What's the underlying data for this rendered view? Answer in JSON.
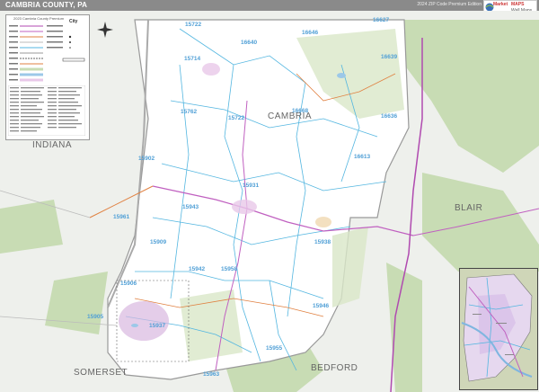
{
  "header": {
    "title": "CAMBRIA COUNTY, PA",
    "edition": "2024 ZIP Code Premium Edition"
  },
  "logo": {
    "line1": "Market",
    "line2": "MAPS",
    "line3": "Wall Maps"
  },
  "legend": {
    "title": "2023 Cambria County Premium",
    "city_label": "City"
  },
  "county_labels": {
    "cambria": "CAMBRIA",
    "indiana": "INDIANA",
    "blair": "BLAIR",
    "somerset": "SOMERSET",
    "bedford": "BEDFORD"
  },
  "zip_labels": [
    {
      "id": "z15722",
      "text": "15722"
    },
    {
      "id": "z15646",
      "text": "15646"
    },
    {
      "id": "z16640",
      "text": "16640"
    },
    {
      "id": "z15714",
      "text": "15714"
    },
    {
      "id": "z16646",
      "text": "16646"
    },
    {
      "id": "z16627",
      "text": "16627"
    },
    {
      "id": "z16639",
      "text": "16639"
    },
    {
      "id": "z15762",
      "text": "15762"
    },
    {
      "id": "z15722b",
      "text": "15722"
    },
    {
      "id": "z16668",
      "text": "16668"
    },
    {
      "id": "z16636",
      "text": "16636"
    },
    {
      "id": "z16613",
      "text": "16613"
    },
    {
      "id": "z15902",
      "text": "15902"
    },
    {
      "id": "z15931",
      "text": "15931"
    },
    {
      "id": "z15943",
      "text": "15943"
    },
    {
      "id": "z15961",
      "text": "15961"
    },
    {
      "id": "z15909",
      "text": "15909"
    },
    {
      "id": "z15938",
      "text": "15938"
    },
    {
      "id": "z15946",
      "text": "15946"
    },
    {
      "id": "z15906",
      "text": "15906"
    },
    {
      "id": "z15942",
      "text": "15942"
    },
    {
      "id": "z15958",
      "text": "15958"
    },
    {
      "id": "z15905",
      "text": "15905"
    },
    {
      "id": "z15937",
      "text": "15937"
    },
    {
      "id": "z15955",
      "text": "15955"
    },
    {
      "id": "z15963",
      "text": "15963"
    },
    {
      "id": "z15940",
      "text": "15940"
    }
  ]
}
